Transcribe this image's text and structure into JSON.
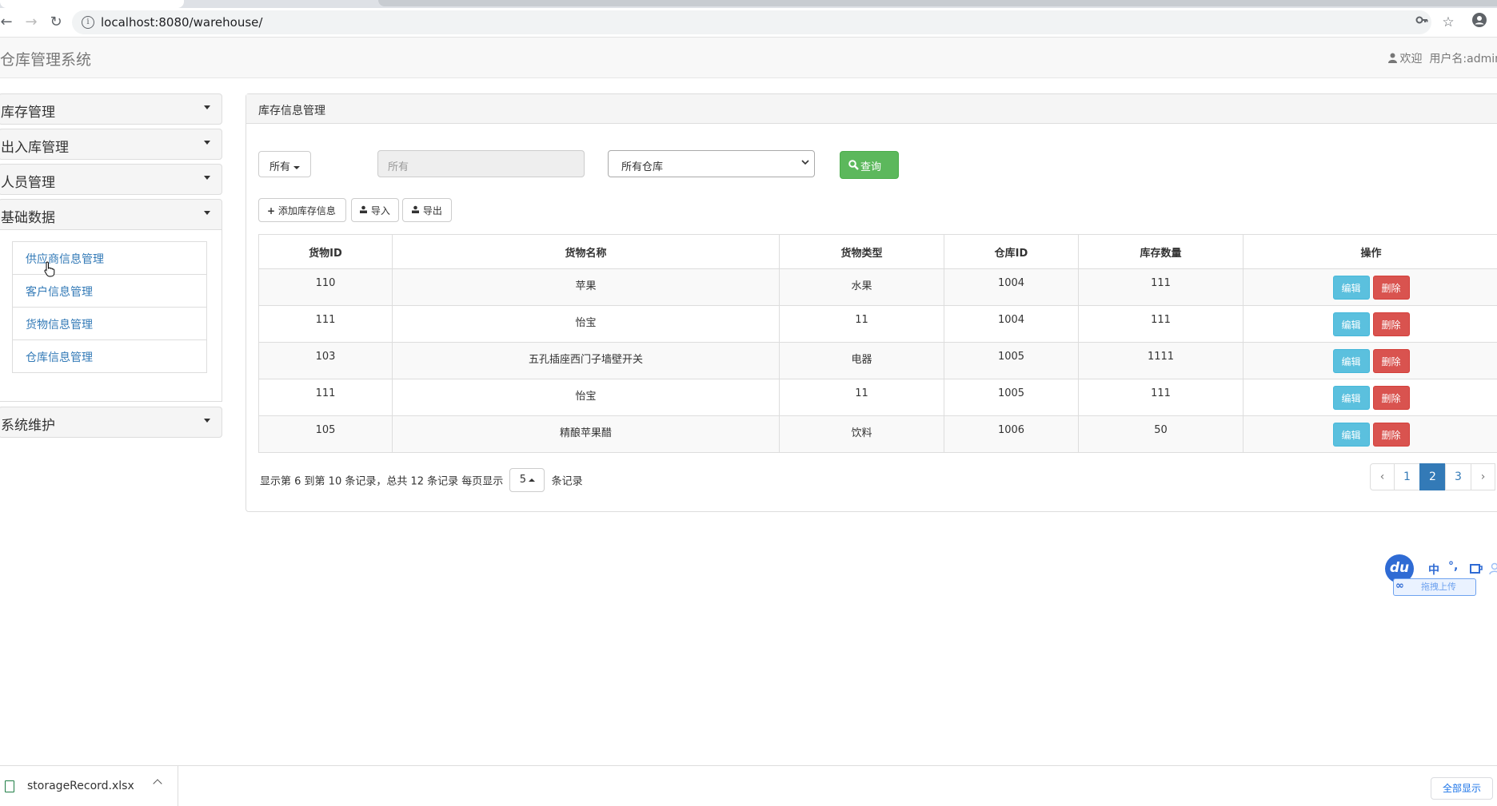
{
  "browser": {
    "url": "localhost:8080/warehouse/"
  },
  "header": {
    "brand": "仓库管理系统",
    "welcome": "欢迎",
    "username": "用户名:admin"
  },
  "sidebar": {
    "sections": [
      {
        "label": "库存管理"
      },
      {
        "label": "出入库管理"
      },
      {
        "label": "人员管理"
      },
      {
        "label": "基础数据"
      },
      {
        "label": "系统维护"
      }
    ],
    "base_items": [
      {
        "label": "供应商信息管理"
      },
      {
        "label": "客户信息管理"
      },
      {
        "label": "货物信息管理"
      },
      {
        "label": "仓库信息管理"
      }
    ]
  },
  "main": {
    "title": "库存信息管理",
    "filter": {
      "type_select": "所有",
      "search_placeholder": "所有",
      "warehouse_select": "所有仓库",
      "query_label": "查询"
    },
    "actions": {
      "add_label": "添加库存信息",
      "import_label": "导入",
      "export_label": "导出"
    },
    "table": {
      "headers": [
        "货物ID",
        "货物名称",
        "货物类型",
        "仓库ID",
        "库存数量",
        "操作"
      ],
      "rows": [
        {
          "id": "110",
          "name": "苹果",
          "type": "水果",
          "warehouse": "1004",
          "qty": "111"
        },
        {
          "id": "111",
          "name": "怡宝",
          "type": "11",
          "warehouse": "1004",
          "qty": "111"
        },
        {
          "id": "103",
          "name": "五孔插座西门子墙壁开关",
          "type": "电器",
          "warehouse": "1005",
          "qty": "1111"
        },
        {
          "id": "111",
          "name": "怡宝",
          "type": "11",
          "warehouse": "1005",
          "qty": "111"
        },
        {
          "id": "105",
          "name": "精酿苹果醋",
          "type": "饮料",
          "warehouse": "1006",
          "qty": "50"
        }
      ],
      "edit_label": "编辑",
      "delete_label": "删除"
    },
    "pagination": {
      "info_before": "显示第 6 到第 10 条记录，总共 12 条记录 每页显示",
      "page_size": "5",
      "info_after": "条记录",
      "prev": "‹",
      "next": "›",
      "pages": [
        "1",
        "2",
        "3"
      ],
      "current": "2"
    }
  },
  "ime": {
    "logo": "du",
    "mode": "中",
    "punct": "°,",
    "upload_label": "拖拽上传"
  },
  "downloads": {
    "filename": "storageRecord.xlsx",
    "show_all": "全部显示"
  },
  "colors": {
    "primary": "#337ab7",
    "success": "#5cb85c",
    "info": "#5bc0de",
    "danger": "#d9534f"
  }
}
